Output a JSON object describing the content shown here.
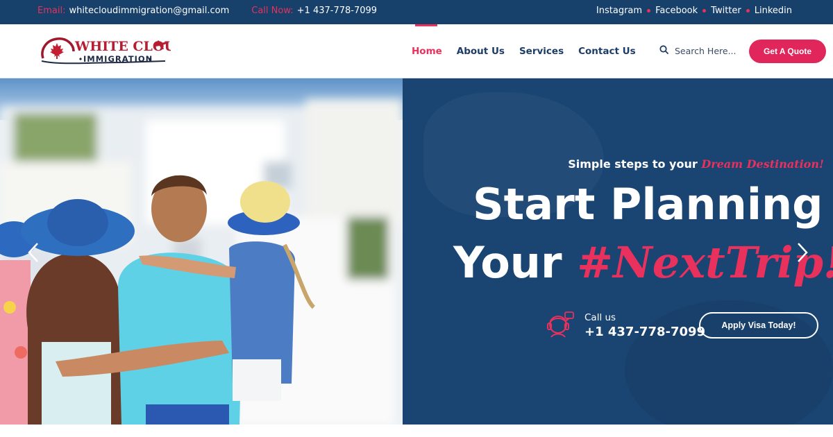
{
  "topbar": {
    "email_label": "Email:",
    "email": "whitecloudimmigration@gmail.com",
    "call_label": "Call Now:",
    "phone": "+1 437-778-7099",
    "social": [
      "Instagram",
      "Facebook",
      "Twitter",
      "Linkedin"
    ]
  },
  "header": {
    "logo": {
      "line1": "WHITE CLOUD",
      "line2": "IMMIGRATION"
    },
    "nav": [
      "Home",
      "About Us",
      "Services",
      "Contact Us"
    ],
    "active_nav": "Home",
    "search_placeholder": "Search Here...",
    "quote_button": "Get A Quote"
  },
  "hero": {
    "tagline": "Simple steps to your",
    "tagline_script": "Dream Destination!",
    "headline_line1": "Start Planning",
    "headline_line2": "Your",
    "headline_script": "#NextTrip!",
    "call_label": "Call us",
    "call_number": "+1 437-778-7099",
    "apply_button": "Apply Visa Today!"
  },
  "icons": {
    "search": "search-icon",
    "phone": "support-agent-icon",
    "prev": "chevron-left-icon",
    "next": "chevron-right-icon",
    "logo_leaf": "maple-leaf-icon",
    "logo_plane": "airplane-icon"
  },
  "colors": {
    "topbar_bg": "#17406b",
    "accent": "#e8315c",
    "nav_text": "#1d3d66",
    "panel_bg": "#1a4472"
  }
}
